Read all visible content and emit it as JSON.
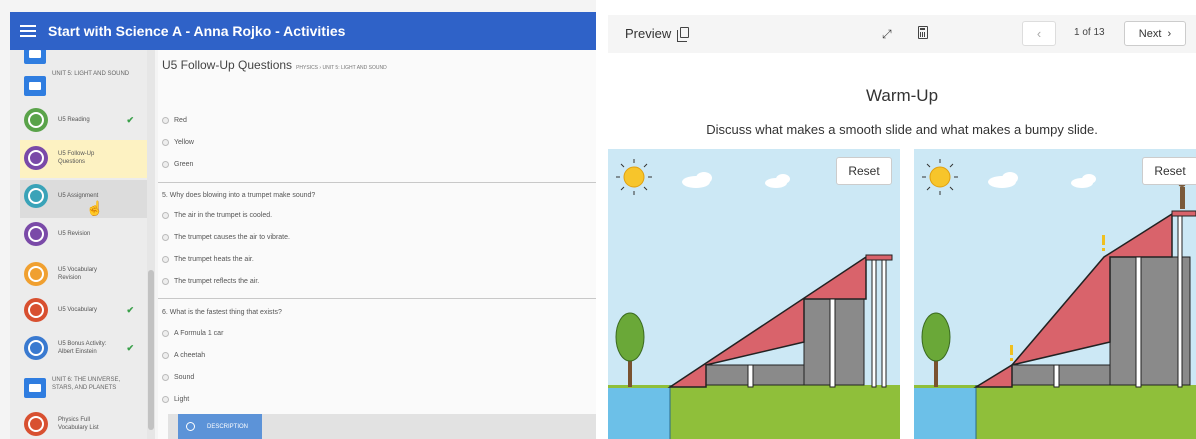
{
  "left": {
    "header": {
      "title": "Start with Science A - Anna Rojko - Activities"
    },
    "sidebar": {
      "unit5": "UNIT 5: LIGHT AND SOUND",
      "items": [
        {
          "label": "U5 Reading",
          "check": "✔",
          "color": "#5aa34a"
        },
        {
          "label": "U5 Follow-Up Questions",
          "check": "",
          "color": "#7a4aa8"
        },
        {
          "label": "U5 Assignment",
          "check": "",
          "color": "#3aa3b8"
        },
        {
          "label": "U5 Revision",
          "check": "",
          "color": "#7a4aa8"
        },
        {
          "label": "U5 Vocabulary Revision",
          "check": "",
          "color": "#f0a030"
        },
        {
          "label": "U5 Vocabulary",
          "check": "✔",
          "color": "#d85030"
        },
        {
          "label": "U5 Bonus Activity: Albert Einstein",
          "check": "✔",
          "color": "#3a7ad0"
        }
      ],
      "unit6": "UNIT 6: THE UNIVERSE, STARS, AND PLANETS",
      "last": {
        "label": "Physics Full Vocabulary List",
        "color": "#d85030"
      }
    },
    "content": {
      "title": "U5 Follow-Up Questions",
      "breadcrumb": "PHYSICS › UNIT 5: LIGHT AND SOUND",
      "q4_options": [
        "Red",
        "Yellow",
        "Green"
      ],
      "q5": "5. Why does blowing into a trumpet make sound?",
      "q5_options": [
        "The air in the trumpet is cooled.",
        "The trumpet causes the air to vibrate.",
        "The trumpet heats the air.",
        "The trumpet reflects the air."
      ],
      "q6": "6. What is the fastest thing that exists?",
      "q6_options": [
        "A Formula 1 car",
        "A cheetah",
        "Sound",
        "Light"
      ],
      "description_tab": "DESCRIPTION"
    }
  },
  "right": {
    "preview_label": "Preview",
    "pager": "1 of 13",
    "next_label": "Next",
    "title": "Warm-Up",
    "prompt": "Discuss what makes a smooth slide and what makes a bumpy slide.",
    "reset_label": "Reset"
  },
  "colors": {
    "header_blue": "#2f62c8",
    "slide_red": "#d9636b",
    "grass": "#8fbf3a",
    "sky": "#cce8f5",
    "water": "#6cc0e8"
  }
}
